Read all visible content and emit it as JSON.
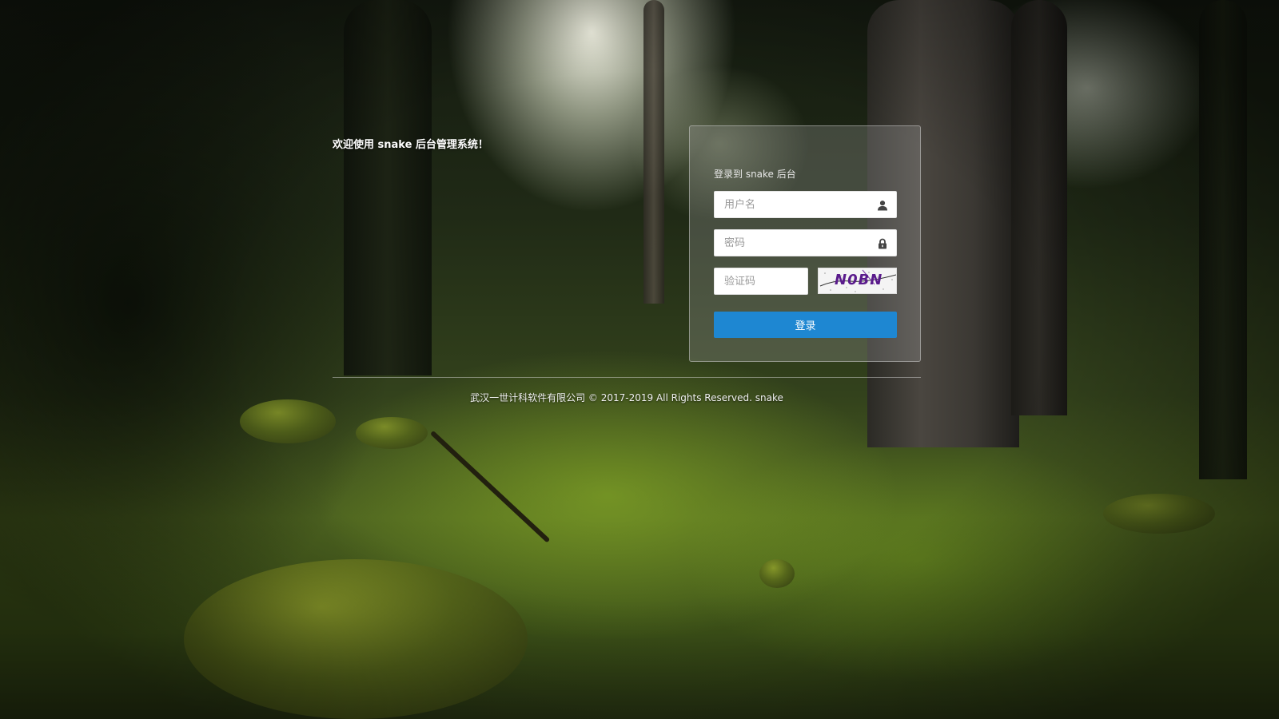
{
  "welcome": {
    "text": "欢迎使用 snake 后台管理系统！"
  },
  "login": {
    "heading": "登录到 snake 后台",
    "username": {
      "placeholder": "用户名",
      "value": "",
      "icon": "user-icon"
    },
    "password": {
      "placeholder": "密码",
      "value": "",
      "icon": "lock-icon"
    },
    "captcha_input": {
      "placeholder": "验证码",
      "value": ""
    },
    "captcha_image": {
      "text": "N0BN"
    },
    "submit_label": "登录"
  },
  "footer": {
    "copyright": "武汉一世计科软件有限公司 © 2017-2019 All Rights Reserved. snake"
  },
  "colors": {
    "button_primary": "#1e87d2",
    "captcha_text": "#5a1b8c",
    "panel_border": "#dcdcdc"
  }
}
